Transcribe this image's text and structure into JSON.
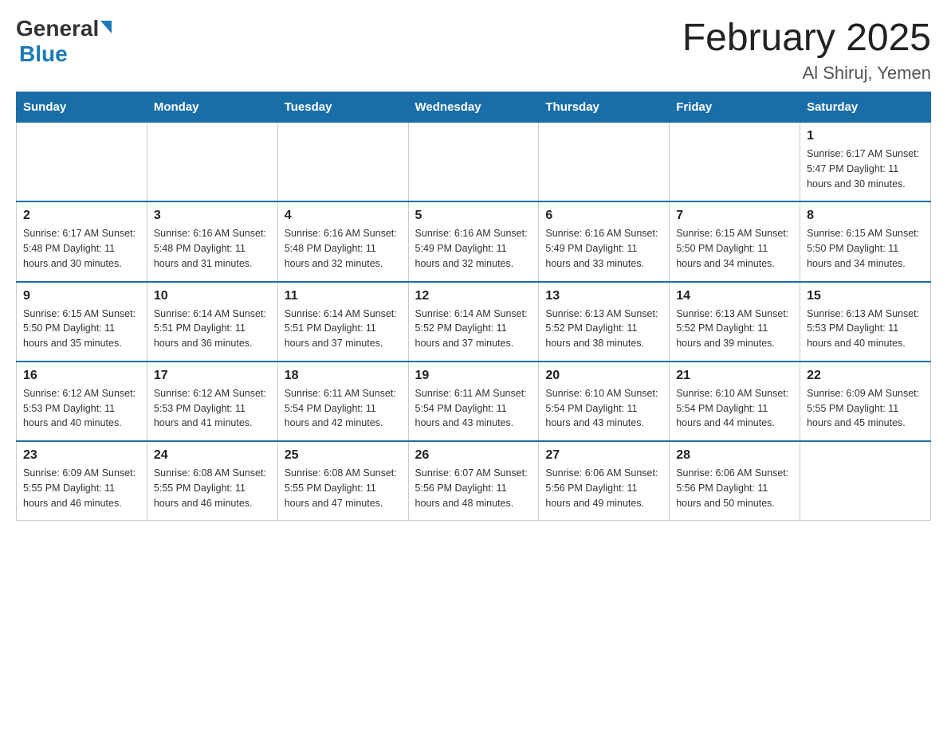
{
  "header": {
    "logo_general": "General",
    "logo_blue": "Blue",
    "month_title": "February 2025",
    "location": "Al Shiruj, Yemen"
  },
  "days_of_week": [
    "Sunday",
    "Monday",
    "Tuesday",
    "Wednesday",
    "Thursday",
    "Friday",
    "Saturday"
  ],
  "weeks": [
    [
      {
        "day": "",
        "info": ""
      },
      {
        "day": "",
        "info": ""
      },
      {
        "day": "",
        "info": ""
      },
      {
        "day": "",
        "info": ""
      },
      {
        "day": "",
        "info": ""
      },
      {
        "day": "",
        "info": ""
      },
      {
        "day": "1",
        "info": "Sunrise: 6:17 AM\nSunset: 5:47 PM\nDaylight: 11 hours\nand 30 minutes."
      }
    ],
    [
      {
        "day": "2",
        "info": "Sunrise: 6:17 AM\nSunset: 5:48 PM\nDaylight: 11 hours\nand 30 minutes."
      },
      {
        "day": "3",
        "info": "Sunrise: 6:16 AM\nSunset: 5:48 PM\nDaylight: 11 hours\nand 31 minutes."
      },
      {
        "day": "4",
        "info": "Sunrise: 6:16 AM\nSunset: 5:48 PM\nDaylight: 11 hours\nand 32 minutes."
      },
      {
        "day": "5",
        "info": "Sunrise: 6:16 AM\nSunset: 5:49 PM\nDaylight: 11 hours\nand 32 minutes."
      },
      {
        "day": "6",
        "info": "Sunrise: 6:16 AM\nSunset: 5:49 PM\nDaylight: 11 hours\nand 33 minutes."
      },
      {
        "day": "7",
        "info": "Sunrise: 6:15 AM\nSunset: 5:50 PM\nDaylight: 11 hours\nand 34 minutes."
      },
      {
        "day": "8",
        "info": "Sunrise: 6:15 AM\nSunset: 5:50 PM\nDaylight: 11 hours\nand 34 minutes."
      }
    ],
    [
      {
        "day": "9",
        "info": "Sunrise: 6:15 AM\nSunset: 5:50 PM\nDaylight: 11 hours\nand 35 minutes."
      },
      {
        "day": "10",
        "info": "Sunrise: 6:14 AM\nSunset: 5:51 PM\nDaylight: 11 hours\nand 36 minutes."
      },
      {
        "day": "11",
        "info": "Sunrise: 6:14 AM\nSunset: 5:51 PM\nDaylight: 11 hours\nand 37 minutes."
      },
      {
        "day": "12",
        "info": "Sunrise: 6:14 AM\nSunset: 5:52 PM\nDaylight: 11 hours\nand 37 minutes."
      },
      {
        "day": "13",
        "info": "Sunrise: 6:13 AM\nSunset: 5:52 PM\nDaylight: 11 hours\nand 38 minutes."
      },
      {
        "day": "14",
        "info": "Sunrise: 6:13 AM\nSunset: 5:52 PM\nDaylight: 11 hours\nand 39 minutes."
      },
      {
        "day": "15",
        "info": "Sunrise: 6:13 AM\nSunset: 5:53 PM\nDaylight: 11 hours\nand 40 minutes."
      }
    ],
    [
      {
        "day": "16",
        "info": "Sunrise: 6:12 AM\nSunset: 5:53 PM\nDaylight: 11 hours\nand 40 minutes."
      },
      {
        "day": "17",
        "info": "Sunrise: 6:12 AM\nSunset: 5:53 PM\nDaylight: 11 hours\nand 41 minutes."
      },
      {
        "day": "18",
        "info": "Sunrise: 6:11 AM\nSunset: 5:54 PM\nDaylight: 11 hours\nand 42 minutes."
      },
      {
        "day": "19",
        "info": "Sunrise: 6:11 AM\nSunset: 5:54 PM\nDaylight: 11 hours\nand 43 minutes."
      },
      {
        "day": "20",
        "info": "Sunrise: 6:10 AM\nSunset: 5:54 PM\nDaylight: 11 hours\nand 43 minutes."
      },
      {
        "day": "21",
        "info": "Sunrise: 6:10 AM\nSunset: 5:54 PM\nDaylight: 11 hours\nand 44 minutes."
      },
      {
        "day": "22",
        "info": "Sunrise: 6:09 AM\nSunset: 5:55 PM\nDaylight: 11 hours\nand 45 minutes."
      }
    ],
    [
      {
        "day": "23",
        "info": "Sunrise: 6:09 AM\nSunset: 5:55 PM\nDaylight: 11 hours\nand 46 minutes."
      },
      {
        "day": "24",
        "info": "Sunrise: 6:08 AM\nSunset: 5:55 PM\nDaylight: 11 hours\nand 46 minutes."
      },
      {
        "day": "25",
        "info": "Sunrise: 6:08 AM\nSunset: 5:55 PM\nDaylight: 11 hours\nand 47 minutes."
      },
      {
        "day": "26",
        "info": "Sunrise: 6:07 AM\nSunset: 5:56 PM\nDaylight: 11 hours\nand 48 minutes."
      },
      {
        "day": "27",
        "info": "Sunrise: 6:06 AM\nSunset: 5:56 PM\nDaylight: 11 hours\nand 49 minutes."
      },
      {
        "day": "28",
        "info": "Sunrise: 6:06 AM\nSunset: 5:56 PM\nDaylight: 11 hours\nand 50 minutes."
      },
      {
        "day": "",
        "info": ""
      }
    ]
  ]
}
